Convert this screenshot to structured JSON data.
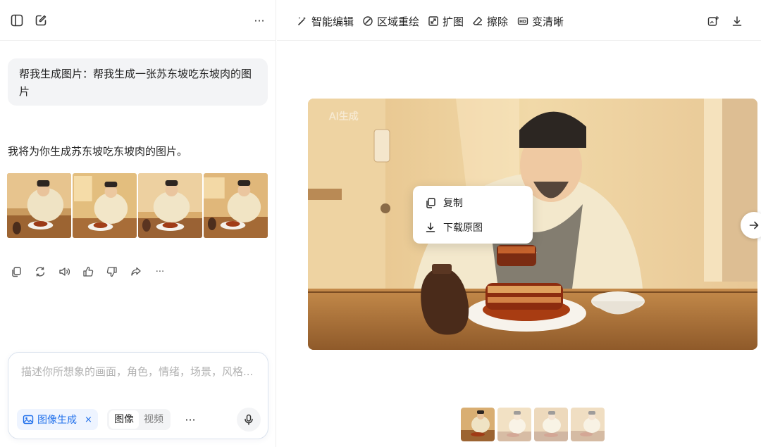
{
  "sidebar_top": {
    "icons": [
      "sidebar-toggle-icon",
      "new-chat-icon",
      "more-icon"
    ],
    "more_label": "···"
  },
  "conversation": {
    "user_message": "帮我生成图片：帮我生成一张苏东坡吃东坡肉的图片",
    "assistant_reply": "我将为你生成苏东坡吃东坡肉的图片。",
    "image_count": 4,
    "action_icons": [
      "copy-icon",
      "regenerate-icon",
      "read-aloud-icon",
      "like-icon",
      "dislike-icon",
      "share-icon",
      "more-icon"
    ],
    "more_label": "···"
  },
  "composer": {
    "placeholder": "描述你所想象的画面，角色，情绪，场景，风格...",
    "mode_chip": "图像生成",
    "chip_close": "×",
    "seg_image": "图像",
    "seg_video": "视频",
    "more_label": "···"
  },
  "toolbar": {
    "smart_edit": "智能编辑",
    "region_redraw": "区域重绘",
    "expand": "扩图",
    "erase": "擦除",
    "upscale": "变清晰"
  },
  "viewer": {
    "watermark": "AI生成",
    "context_menu": {
      "copy": "复制",
      "download": "下载原图"
    },
    "selected_index": 0
  },
  "colors": {
    "accent": "#1f6feb",
    "bubble_bg": "#f3f4f6"
  }
}
